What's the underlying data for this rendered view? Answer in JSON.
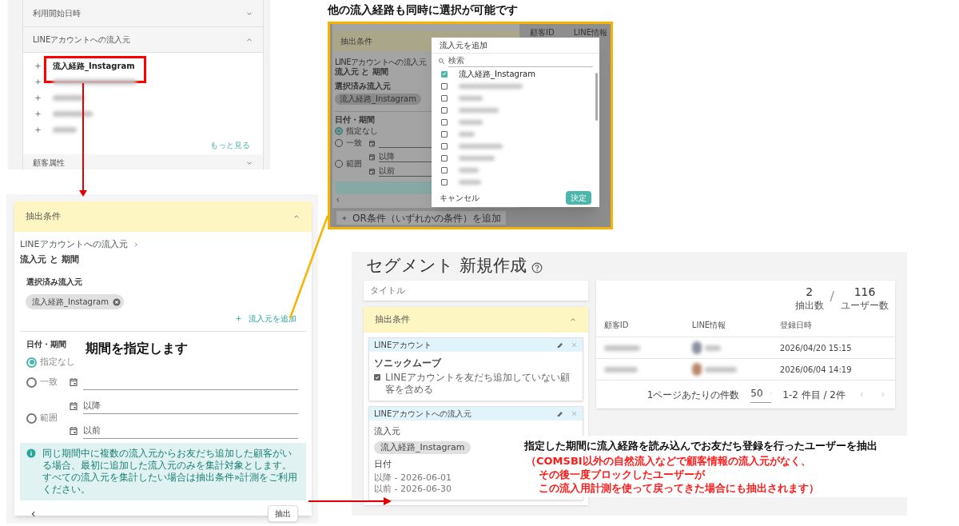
{
  "accordion_screenshot": {
    "sections": [
      {
        "title": "利用開始日時",
        "expanded": false
      },
      {
        "title": "LINEアカウントへの流入元",
        "expanded": true,
        "items": [
          {
            "label": "流入経路_Instagram",
            "blurred": false,
            "highlighted": true
          },
          {
            "blurred": true,
            "highlighted": false
          },
          {
            "blurred": true,
            "highlighted": false
          },
          {
            "blurred": true,
            "highlighted": false
          },
          {
            "blurred": true,
            "highlighted": false
          }
        ],
        "more_link": "もっと見る"
      },
      {
        "title": "顧客属性",
        "expanded": false
      }
    ]
  },
  "multi_select_caption": "他の流入経路も同時に選択が可能です",
  "multi_select_screenshot": {
    "background": {
      "header": "抽出条件",
      "breadcrumb": "LINEアカウントへの流入元",
      "subtitle": "流入元 と 期間",
      "selected_label": "選択済み流入元",
      "chip": "流入経路_Instagram",
      "date_label": "日付・期間",
      "options": [
        {
          "kind": "none",
          "label": "指定なし",
          "selected": true
        },
        {
          "kind": "exact",
          "label": "一致",
          "selected": false
        },
        {
          "kind": "range",
          "label": "範囲",
          "selected": false,
          "fields": [
            {
              "placeholder": "以降"
            },
            {
              "placeholder": "以前"
            }
          ]
        }
      ],
      "add_or": "OR条件（いずれかの条件）を追加",
      "columns": [
        "顧客ID",
        "LINE情報"
      ]
    },
    "modal": {
      "title": "流入元を追加",
      "search_placeholder": "検索",
      "items": [
        {
          "label": "流入経路_Instagram",
          "checked": true,
          "blurred": false
        },
        {
          "checked": false,
          "blurred": true
        },
        {
          "checked": false,
          "blurred": true
        },
        {
          "checked": false,
          "blurred": true
        },
        {
          "checked": false,
          "blurred": true
        },
        {
          "checked": false,
          "blurred": true
        },
        {
          "checked": false,
          "blurred": true
        },
        {
          "checked": false,
          "blurred": true
        },
        {
          "checked": false,
          "blurred": true
        },
        {
          "checked": false,
          "blurred": true
        }
      ],
      "cancel": "キャンセル",
      "confirm": "決定"
    }
  },
  "condition_editor": {
    "header": "抽出条件",
    "expanded": true,
    "breadcrumb": "LINEアカウントへの流入元",
    "subtitle": "流入元 と 期間",
    "selected_label": "選択済み流入元",
    "chips": [
      "流入経路_Instagram"
    ],
    "add_button": "流入元を追加",
    "date_label": "日付・期間",
    "options": [
      {
        "kind": "none",
        "label": "指定なし",
        "selected": true
      },
      {
        "kind": "exact",
        "label": "一致",
        "selected": false
      },
      {
        "kind": "range",
        "label": "範囲",
        "selected": false,
        "fields": [
          {
            "placeholder": "以降"
          },
          {
            "placeholder": "以前"
          }
        ]
      }
    ],
    "info": "同じ期間中に複数の流入元からお友だち追加した顧客がいる場合、最初に追加した流入元のみを集計対象とします。すべての流入元を集計したい場合は抽出条件»計測をご利用ください。",
    "extract_button": "抽出"
  },
  "period_note": "期間を指定します",
  "segment_screenshot": {
    "title": "セグメント 新規作成",
    "title_placeholder": "タイトル",
    "conditions_header": "抽出条件",
    "conditions_expanded": true,
    "conditions": [
      {
        "kind": "account",
        "header": "LINEアカウント",
        "name": "ソニックムーブ",
        "option": {
          "label": "LINEアカウントを友だち追加していない顧客を含める",
          "checked": true
        }
      },
      {
        "kind": "source",
        "header": "LINEアカウントへの流入元",
        "source_label": "流入元",
        "chips": [
          "流入経路_Instagram"
        ],
        "date_label": "日付",
        "dates": [
          "以降 - 2026-06-01",
          "以前 - 2026-06-30"
        ]
      }
    ],
    "results": {
      "extracted": "2",
      "extracted_label": "抽出数",
      "separator": "/",
      "total": "116",
      "total_label": "ユーザー数",
      "columns": [
        "顧客ID",
        "LINE情報",
        "登録日時"
      ],
      "rows": [
        {
          "registered": "2026/04/20 15:15"
        },
        {
          "registered": "2026/06/04 14:19"
        }
      ],
      "per_page_label": "1ページあたりの件数",
      "per_page": "50",
      "range": "1-2 件目 / 2件"
    }
  },
  "callout": {
    "text": "指定した期間に流入経路を読み込んでお友だち登録を行ったユーザーを抽出",
    "detail_lines": [
      "（COMSBI以外の自然流入などで顧客情報の流入元がなく、",
      "その後一度ブロックしたユーザーが",
      "この流入用計測を使って戻ってきた場合にも抽出されます）"
    ]
  }
}
